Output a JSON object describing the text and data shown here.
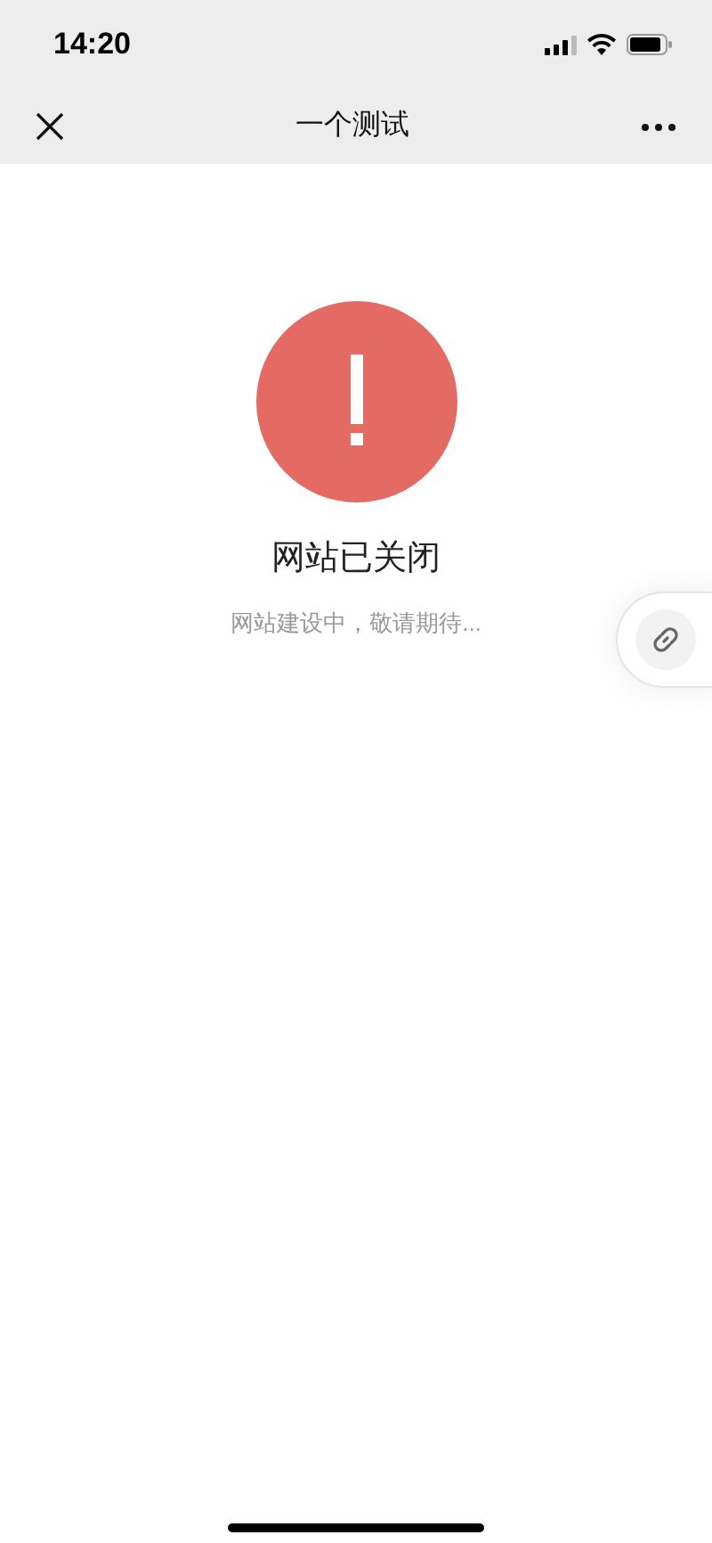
{
  "status_bar": {
    "time": "14:20"
  },
  "nav_bar": {
    "title": "一个测试"
  },
  "message": {
    "title": "网站已关闭",
    "subtitle": "网站建设中，敬请期待..."
  }
}
